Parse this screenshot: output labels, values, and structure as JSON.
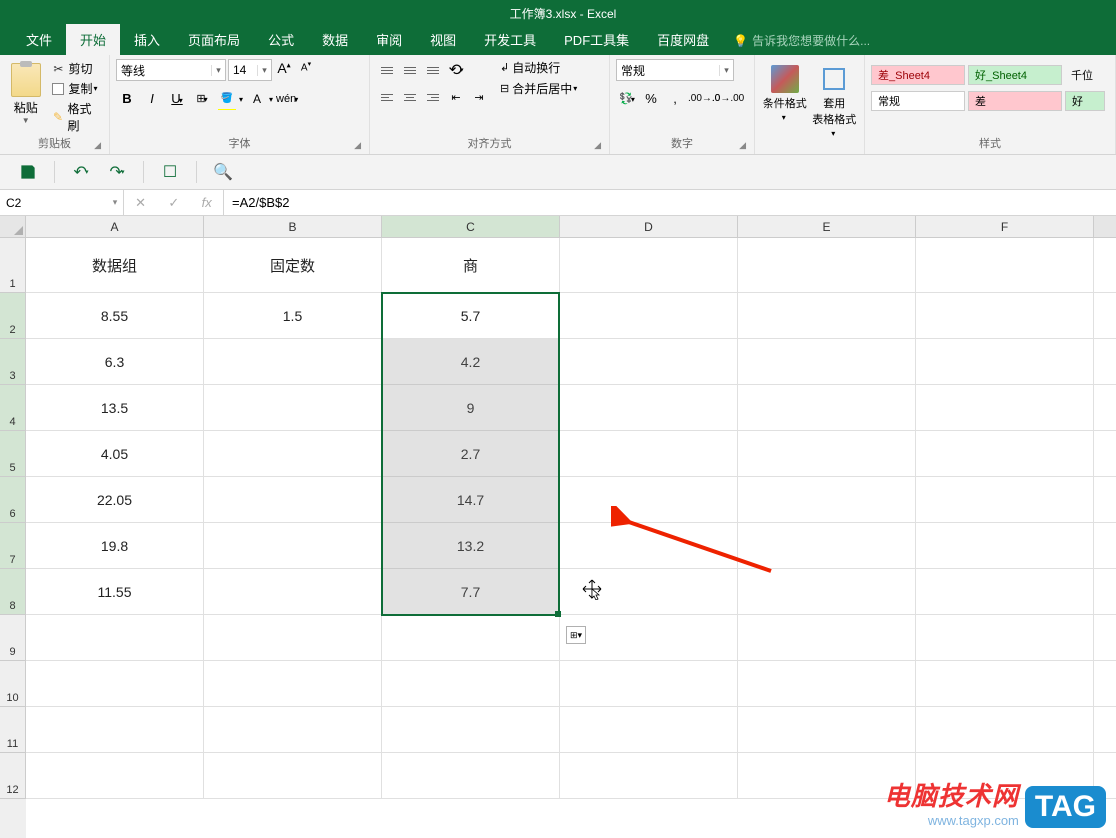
{
  "app": {
    "title": "工作簿3.xlsx - Excel"
  },
  "tabs": [
    "文件",
    "开始",
    "插入",
    "页面布局",
    "公式",
    "数据",
    "审阅",
    "视图",
    "开发工具",
    "PDF工具集",
    "百度网盘"
  ],
  "tellme": "告诉我您想要做什么...",
  "clipboard": {
    "paste": "粘贴",
    "cut": "剪切",
    "copy": "复制",
    "painter": "格式刷",
    "label": "剪贴板"
  },
  "font": {
    "name": "等线",
    "size": "14",
    "label": "字体",
    "wen": "wén"
  },
  "align": {
    "wrap": "自动换行",
    "merge": "合并后居中",
    "label": "对齐方式"
  },
  "number": {
    "format": "常规",
    "label": "数字"
  },
  "styles": {
    "cond": "条件格式",
    "table": "套用\n表格格式",
    "label": "样式",
    "bad": "差_Sheet4",
    "good": "好_Sheet4",
    "qw": "千位",
    "normal": "常规",
    "diff": "差",
    "hao": "好"
  },
  "namebox": "C2",
  "formula": "=A2/$B$2",
  "col_headers": [
    "A",
    "B",
    "C",
    "D",
    "E",
    "F"
  ],
  "row_headers": [
    "1",
    "2",
    "3",
    "4",
    "5",
    "6",
    "7",
    "8",
    "9",
    "10",
    "11",
    "12"
  ],
  "chart_data": {
    "type": "table",
    "columns": [
      "数据组",
      "固定数",
      "商"
    ],
    "rows": [
      [
        "8.55",
        "1.5",
        "5.7"
      ],
      [
        "6.3",
        "",
        "4.2"
      ],
      [
        "13.5",
        "",
        "9"
      ],
      [
        "4.05",
        "",
        "2.7"
      ],
      [
        "22.05",
        "",
        "14.7"
      ],
      [
        "19.8",
        "",
        "13.2"
      ],
      [
        "11.55",
        "",
        "7.7"
      ]
    ]
  },
  "watermark": {
    "line1": "电脑技术网",
    "line2": "www.tagxp.com",
    "tag": "TAG"
  }
}
